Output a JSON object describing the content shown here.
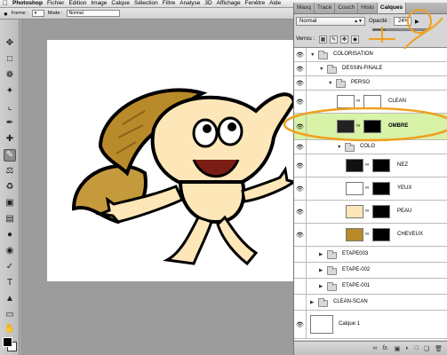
{
  "menubar": {
    "apple": "",
    "items": [
      "Photoshop",
      "Fichier",
      "Edition",
      "Image",
      "Calque",
      "Sélection",
      "Filtre",
      "Analyse",
      "3D",
      "Affichage",
      "Fenêtre",
      "Aide"
    ]
  },
  "options": {
    "forme_label": "Forme :",
    "mode_label": "Mode :",
    "mode_value": "Normal"
  },
  "panel": {
    "tabs": [
      "Masq",
      "Tracé",
      "Couch",
      "Histo",
      "Calques"
    ],
    "active_tab": "Calques",
    "blend_mode": "Normal",
    "opacity_label": "Opacité :",
    "opacity_value": "24%",
    "opacity_fraction": 0.24,
    "lock_label": "Verrou :"
  },
  "layers": [
    {
      "name": "COLORISATION",
      "kind": "group",
      "visible": true
    },
    {
      "name": "DESSIN-FINALE",
      "kind": "group",
      "visible": true
    },
    {
      "name": "PERSO",
      "kind": "group",
      "visible": true
    },
    {
      "name": "CLEAN",
      "kind": "layer",
      "visible": true
    },
    {
      "name": "OMBRE",
      "kind": "layer",
      "visible": true,
      "selected": true
    },
    {
      "name": "COLO",
      "kind": "group",
      "visible": true
    },
    {
      "name": "NEZ",
      "kind": "layer",
      "visible": true
    },
    {
      "name": "YEUX",
      "kind": "layer",
      "visible": true
    },
    {
      "name": "PEAU",
      "kind": "layer",
      "visible": true
    },
    {
      "name": "CHEVEUX",
      "kind": "layer",
      "visible": true
    },
    {
      "name": "ETAPE003",
      "kind": "group",
      "visible": false
    },
    {
      "name": "ETAPE-002",
      "kind": "group",
      "visible": false
    },
    {
      "name": "ETAPE-001",
      "kind": "group",
      "visible": false
    },
    {
      "name": "CLEAN-SCAN",
      "kind": "group",
      "visible": false
    },
    {
      "name": "Calque 1",
      "kind": "layer",
      "visible": true
    }
  ],
  "colors": {
    "accent": "#f0a020",
    "selection": "#d8f2a8",
    "skin": "#fde7b8",
    "hair": "#b98a2a"
  },
  "bottom_icons": [
    "link-icon",
    "fx-icon",
    "mask-icon",
    "adjustment-icon",
    "folder-icon",
    "new-layer-icon",
    "trash-icon"
  ]
}
